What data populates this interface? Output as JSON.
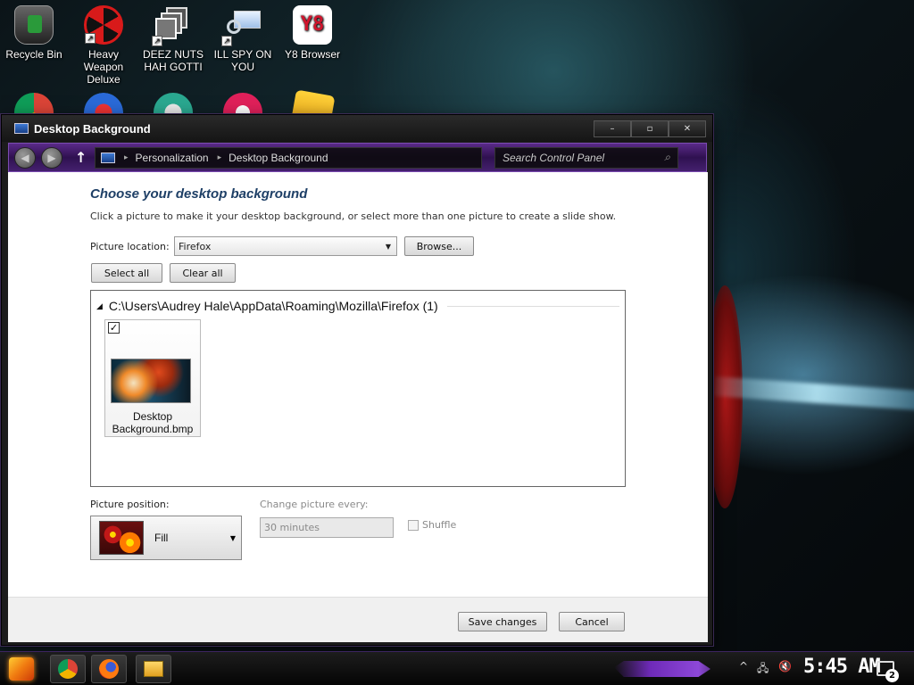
{
  "desktop": {
    "icons": [
      {
        "label": "Recycle Bin"
      },
      {
        "label": "Heavy Weapon Deluxe"
      },
      {
        "label": "DEEZ NUTS HAH GOTTI"
      },
      {
        "label": "ILL SPY ON YOU"
      },
      {
        "label": "Y8 Browser",
        "glyph": "Y8"
      }
    ]
  },
  "window": {
    "title": "Desktop Background",
    "controls": {
      "minimize": "–",
      "maximize": "▫",
      "close": "✕"
    }
  },
  "nav": {
    "back_icon": "◀",
    "forward_icon": "▶",
    "up_icon": "↑",
    "breadcrumb": [
      "Personalization",
      "Desktop Background"
    ],
    "crumb_sep": "▸",
    "search_placeholder": "Search Control Panel",
    "search_icon": "⌕"
  },
  "page": {
    "heading": "Choose your desktop background",
    "description": "Click a picture to make it your desktop background, or select more than one picture to create a slide show.",
    "picture_location_label": "Picture location:",
    "picture_location_value": "Firefox",
    "browse_label": "Browse...",
    "select_all_label": "Select all",
    "clear_all_label": "Clear all",
    "dropdown_caret": "▼"
  },
  "gallery": {
    "group_path": "C:\\Users\\Audrey Hale\\AppData\\Roaming\\Mozilla\\Firefox (1)",
    "group_toggle": "◢",
    "items": [
      {
        "filename": "Desktop Background.bmp",
        "checked_mark": "✓"
      }
    ]
  },
  "position": {
    "label": "Picture position:",
    "value": "Fill"
  },
  "slideshow": {
    "change_label": "Change picture every:",
    "interval_value": "30 minutes",
    "shuffle_label": "Shuffle"
  },
  "footer": {
    "save_label": "Save changes",
    "cancel_label": "Cancel"
  },
  "taskbar": {
    "pinned": [
      "chrome-icon",
      "firefox-icon",
      "file-explorer-icon"
    ],
    "tray_chevron": "^",
    "network_icon": "🖧",
    "volume_icon": "🔇",
    "clock": "5:45 AM",
    "notification_count": "2"
  }
}
